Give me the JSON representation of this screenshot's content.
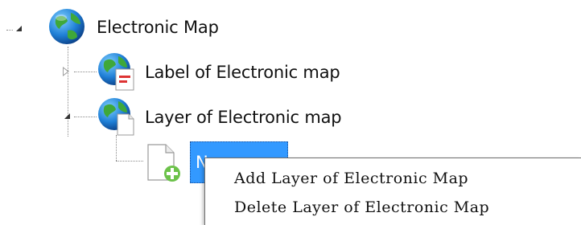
{
  "tree": {
    "root": {
      "label": "Electronic Map",
      "icon": "globe-icon",
      "expanded": true
    },
    "children": [
      {
        "label": "Label of Electronic map",
        "icon": "globe-document-icon",
        "expanded": false
      },
      {
        "label": "Layer of Electronic map",
        "icon": "globe-document-icon",
        "expanded": true,
        "children": [
          {
            "label": "N",
            "icon": "new-document-icon",
            "selected": true
          }
        ]
      }
    ]
  },
  "context_menu": {
    "items": [
      {
        "label": "Add Layer of Electronic Map"
      },
      {
        "label": "Delete Layer of Electronic Map"
      }
    ]
  },
  "colors": {
    "selection": "#3399ff",
    "tree_lines": "#8a8a8a"
  }
}
